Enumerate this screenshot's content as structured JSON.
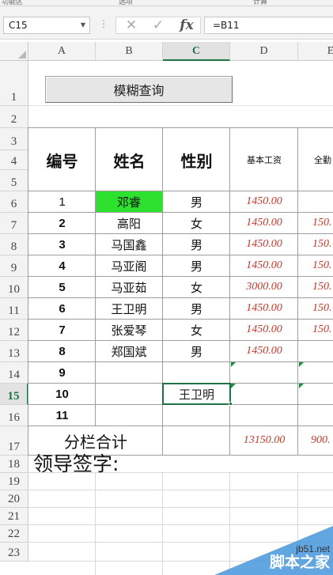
{
  "top_strip": [
    "功能区",
    "选项",
    "计算"
  ],
  "formula_bar": {
    "name_box": "C15",
    "cancel_icon": "✕",
    "enter_icon": "✓",
    "fx_label": "fx",
    "formula": "=B11"
  },
  "columns": [
    {
      "id": "col-a",
      "label": "A"
    },
    {
      "id": "col-b",
      "label": "B"
    },
    {
      "id": "col-c",
      "label": "C"
    },
    {
      "id": "col-d",
      "label": "D"
    },
    {
      "id": "col-e",
      "label": "E"
    }
  ],
  "rows": [
    "1",
    "2",
    "3",
    "4",
    "5",
    "6",
    "7",
    "8",
    "9",
    "10",
    "11",
    "12",
    "13",
    "14",
    "15",
    "16",
    "17",
    "18",
    "19",
    "20",
    "21",
    "22",
    "23"
  ],
  "selected": {
    "column": "C",
    "row": "15"
  },
  "query_button": "模糊查询",
  "headers": {
    "number": "编号",
    "name": "姓名",
    "gender": "性别",
    "base_salary": "基本工资",
    "attendance": "全勤"
  },
  "records": [
    {
      "no": "1",
      "name": "邓睿",
      "gender": "男",
      "salary": "1450.00",
      "e": "",
      "highlight": true
    },
    {
      "no": "2",
      "name": "高阳",
      "gender": "女",
      "salary": "1450.00",
      "e": "150.",
      "highlight": false
    },
    {
      "no": "3",
      "name": "马国鑫",
      "gender": "男",
      "salary": "1450.00",
      "e": "150.",
      "highlight": false
    },
    {
      "no": "4",
      "name": "马亚阁",
      "gender": "男",
      "salary": "1450.00",
      "e": "150.",
      "highlight": false
    },
    {
      "no": "5",
      "name": "马亚茹",
      "gender": "女",
      "salary": "3000.00",
      "e": "150.",
      "highlight": false
    },
    {
      "no": "6",
      "name": "王卫明",
      "gender": "男",
      "salary": "1450.00",
      "e": "150.",
      "highlight": false
    },
    {
      "no": "7",
      "name": "张爱琴",
      "gender": "女",
      "salary": "1450.00",
      "e": "150.",
      "highlight": false
    },
    {
      "no": "8",
      "name": "郑国斌",
      "gender": "男",
      "salary": "1450.00",
      "e": "",
      "highlight": false
    },
    {
      "no": "9",
      "name": "",
      "gender": "",
      "salary": "",
      "e": "",
      "highlight": false
    },
    {
      "no": "10",
      "name": "",
      "gender": "王卫明",
      "salary": "",
      "e": "",
      "highlight": false
    },
    {
      "no": "11",
      "name": "",
      "gender": "",
      "salary": "",
      "e": "",
      "highlight": false
    }
  ],
  "subtotal": {
    "label": "分栏合计",
    "salary": "13150.00",
    "e": "900."
  },
  "signature": "领导签字:",
  "watermark": {
    "site": "jb51.net",
    "name": "脚本之家"
  },
  "colors": {
    "highlight": "#2ee12e",
    "salary_text": "#c0392b",
    "selection": "#217346"
  }
}
